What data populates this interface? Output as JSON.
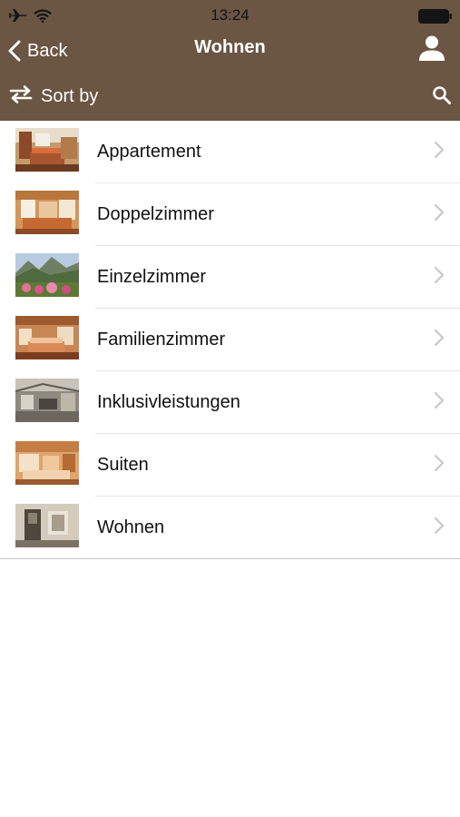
{
  "status_bar": {
    "time": "13:24",
    "airplane_icon": "airplane-icon",
    "wifi_icon": "wifi-icon",
    "battery_icon": "battery-icon"
  },
  "nav": {
    "back_label": "Back",
    "title": "Wohnen",
    "profile_icon": "person-icon"
  },
  "toolbar": {
    "sort_label": "Sort by",
    "sort_icon": "swap-arrows-icon",
    "search_icon": "search-icon"
  },
  "colors": {
    "header_bg": "#6b5543",
    "header_text": "#ffffff",
    "list_text": "#111111",
    "separator": "#e6e6e6",
    "chevron": "#c7c7cc"
  },
  "items": [
    {
      "label": "Appartement"
    },
    {
      "label": "Doppelzimmer"
    },
    {
      "label": "Einzelzimmer"
    },
    {
      "label": "Familienzimmer"
    },
    {
      "label": "Inklusivleistungen"
    },
    {
      "label": "Suiten"
    },
    {
      "label": "Wohnen"
    }
  ]
}
